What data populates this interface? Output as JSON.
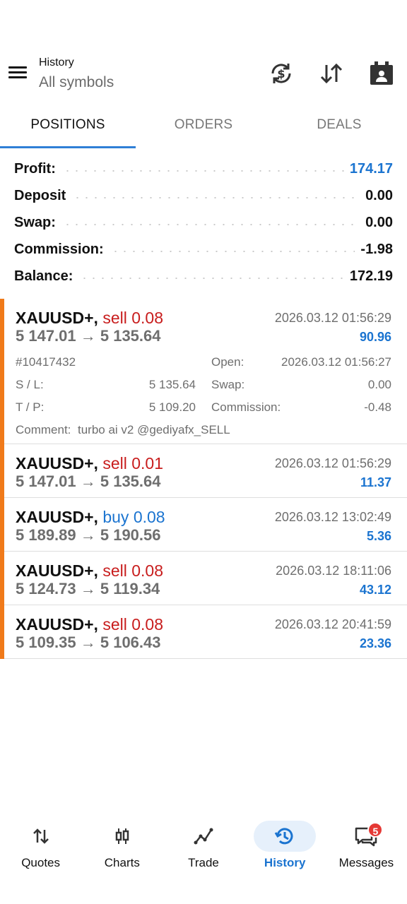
{
  "header": {
    "title": "History",
    "subtitle": "All symbols",
    "icons": [
      "menu-icon",
      "currency-refresh-icon",
      "sort-icon",
      "calendar-icon"
    ]
  },
  "tabs": [
    {
      "label": "POSITIONS",
      "active": true
    },
    {
      "label": "ORDERS",
      "active": false
    },
    {
      "label": "DEALS",
      "active": false
    }
  ],
  "summary": [
    {
      "label": "Profit:",
      "value": "174.17",
      "highlight": true
    },
    {
      "label": "Deposit",
      "value": "0.00"
    },
    {
      "label": "Swap:",
      "value": "0.00"
    },
    {
      "label": "Commission:",
      "value": "-1.98"
    },
    {
      "label": "Balance:",
      "value": "172.19"
    }
  ],
  "positions": [
    {
      "symbol": "XAUUSD+,",
      "side": "sell 0.08",
      "side_type": "sell",
      "prices": "5 147.01 → 5 135.64",
      "time": "2026.03.12 01:56:29",
      "profit": "90.96",
      "details": {
        "ticket": "#10417432",
        "sl_label": "S / L:",
        "sl_value": "5 135.64",
        "tp_label": "T / P:",
        "tp_value": "5 109.20",
        "open_label": "Open:",
        "open_value": "2026.03.12 01:56:27",
        "swap_label": "Swap:",
        "swap_value": "0.00",
        "commission_label": "Commission:",
        "commission_value": "-0.48",
        "comment_label": "Comment:",
        "comment_value": "turbo ai v2 @gediyafx_SELL"
      }
    },
    {
      "symbol": "XAUUSD+,",
      "side": "sell 0.01",
      "side_type": "sell",
      "prices": "5 147.01 → 5 135.64",
      "time": "2026.03.12 01:56:29",
      "profit": "11.37"
    },
    {
      "symbol": "XAUUSD+,",
      "side": "buy 0.08",
      "side_type": "buy",
      "prices": "5 189.89 → 5 190.56",
      "time": "2026.03.12 13:02:49",
      "profit": "5.36"
    },
    {
      "symbol": "XAUUSD+,",
      "side": "sell 0.08",
      "side_type": "sell",
      "prices": "5 124.73 → 5 119.34",
      "time": "2026.03.12 18:11:06",
      "profit": "43.12"
    },
    {
      "symbol": "XAUUSD+,",
      "side": "sell 0.08",
      "side_type": "sell",
      "prices": "5 109.35 → 5 106.43",
      "time": "2026.03.12 20:41:59",
      "profit": "23.36"
    }
  ],
  "bottom_nav": [
    {
      "label": "Quotes",
      "icon": "arrows-updown-icon",
      "active": false
    },
    {
      "label": "Charts",
      "icon": "candlestick-icon",
      "active": false
    },
    {
      "label": "Trade",
      "icon": "trend-line-icon",
      "active": false
    },
    {
      "label": "History",
      "icon": "history-clock-icon",
      "active": true
    },
    {
      "label": "Messages",
      "icon": "messages-icon",
      "active": false,
      "badge": "5"
    }
  ],
  "colors": {
    "accent": "#1b74d0",
    "sell": "#c81d1d",
    "position_marker": "#f07a1a",
    "active_tab_indicator": "#2f7fd6"
  }
}
